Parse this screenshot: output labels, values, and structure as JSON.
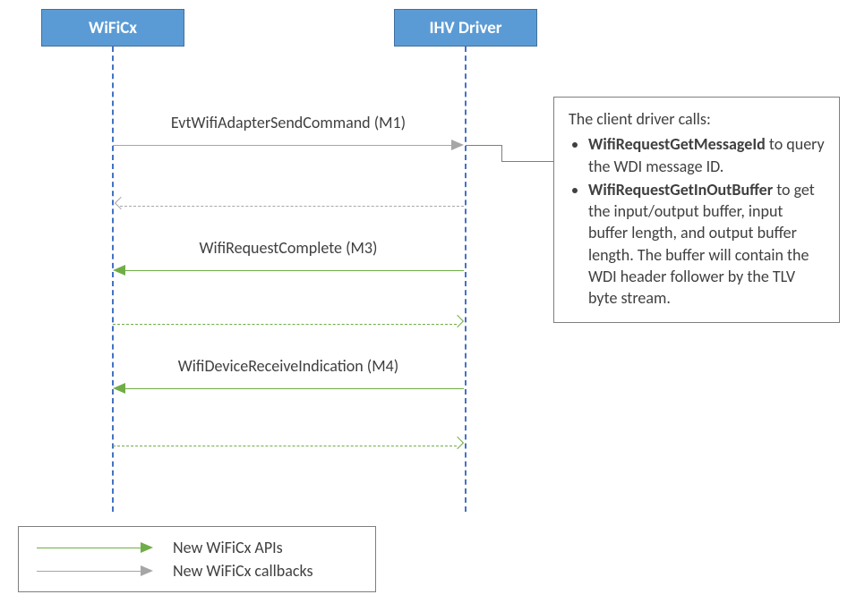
{
  "participants": {
    "left": "WiFiCx",
    "right": "IHV Driver"
  },
  "messages": {
    "m1": "EvtWifiAdapterSendCommand (M1)",
    "m3": "WifiRequestComplete (M3)",
    "m4": "WifiDeviceReceiveIndication (M4)"
  },
  "note": {
    "intro": "The client driver calls:",
    "item1_bold": "WifiRequestGetMessageId",
    "item1_rest": " to query the WDI message ID.",
    "item2_bold": "WifiRequestGetInOutBuffer",
    "item2_rest": " to get the input/output buffer, input buffer length, and output buffer length. The buffer will contain the WDI header follower by the TLV byte stream."
  },
  "legend": {
    "apis": "New WiFiCx APIs",
    "callbacks": "New WiFiCx callbacks"
  }
}
